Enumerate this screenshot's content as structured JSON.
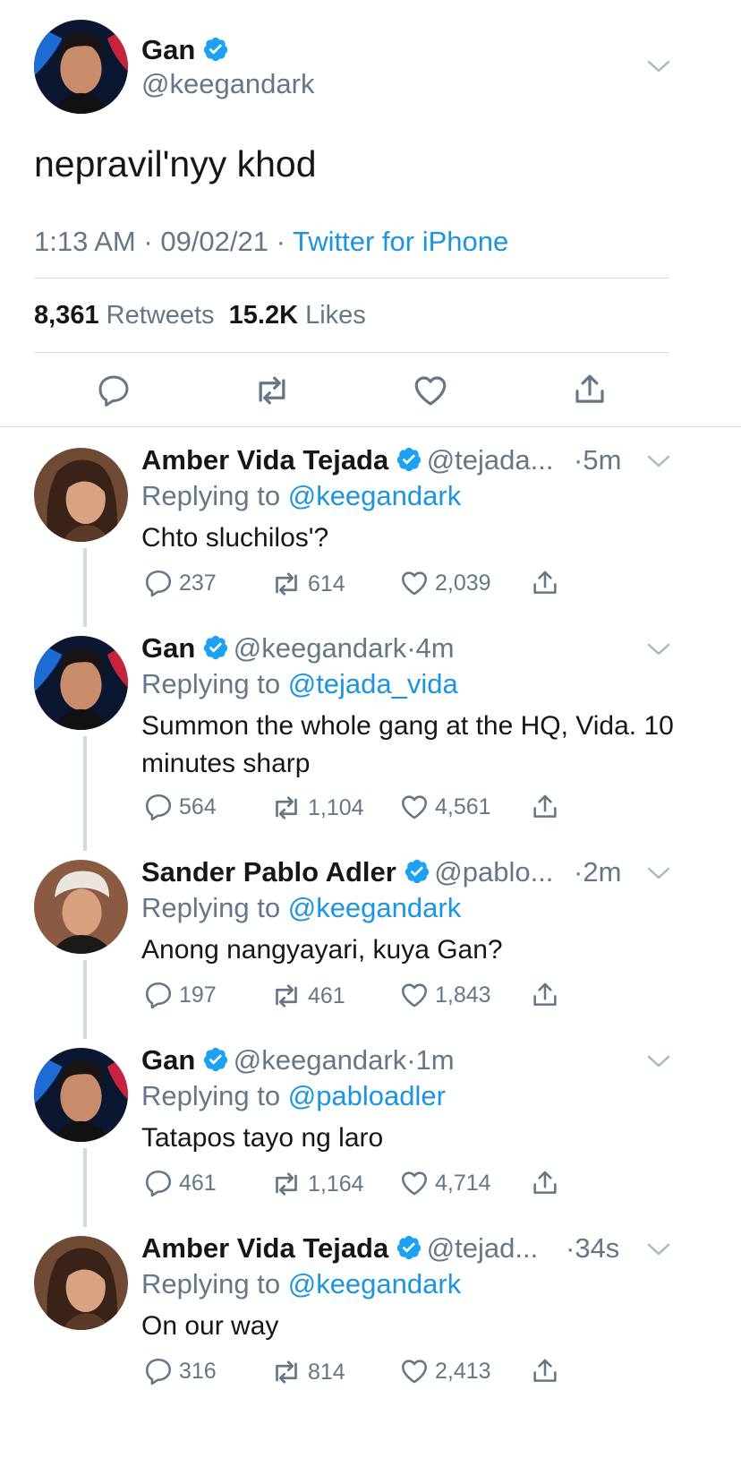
{
  "main_tweet": {
    "name": "Gan",
    "handle": "@keegandark",
    "text": "nepravil'nyy khod",
    "time": "1:13 AM",
    "date": "09/02/21",
    "sep": "·",
    "source": "Twitter for iPhone",
    "retweets_count": "8,361",
    "retweets_label": "Retweets",
    "likes_count": "15.2K",
    "likes_label": "Likes"
  },
  "replies": [
    {
      "name": "Amber Vida Tejada",
      "handle": "@tejada...",
      "time": "·5m",
      "replying_prefix": "Replying to",
      "replying_to": "@keegandark",
      "text": "Chto sluchilos'?",
      "replies": "237",
      "retweets": "614",
      "likes": "2,039"
    },
    {
      "name": "Gan",
      "handle": "@keegandark",
      "time": "·4m",
      "replying_prefix": "Replying to",
      "replying_to": "@tejada_vida",
      "text": "Summon the whole gang at the HQ, Vida. 10 minutes sharp",
      "replies": "564",
      "retweets": "1,104",
      "likes": "4,561"
    },
    {
      "name": "Sander Pablo Adler",
      "handle": "@pablo...",
      "time": "·2m",
      "replying_prefix": "Replying to",
      "replying_to": "@keegandark",
      "text": "Anong nangyayari, kuya Gan?",
      "replies": "197",
      "retweets": "461",
      "likes": "1,843"
    },
    {
      "name": "Gan",
      "handle": "@keegandark",
      "time": "·1m",
      "replying_prefix": "Replying to",
      "replying_to": "@pabloadler",
      "text": "Tatapos tayo ng laro",
      "replies": "461",
      "retweets": "1,164",
      "likes": "4,714"
    },
    {
      "name": "Amber Vida Tejada",
      "handle": "@tejad...",
      "time": "·34s",
      "replying_prefix": "Replying to",
      "replying_to": "@keegandark",
      "text": "On our way",
      "replies": "316",
      "retweets": "814",
      "likes": "2,413"
    }
  ],
  "colors": {
    "link": "#1b95e0",
    "muted": "#657786",
    "verified": "#1da1f2",
    "divider": "#d8dfe3"
  },
  "icons": [
    "verified-badge-icon",
    "chevron-down-icon",
    "reply-icon",
    "retweet-icon",
    "like-icon",
    "share-icon"
  ]
}
